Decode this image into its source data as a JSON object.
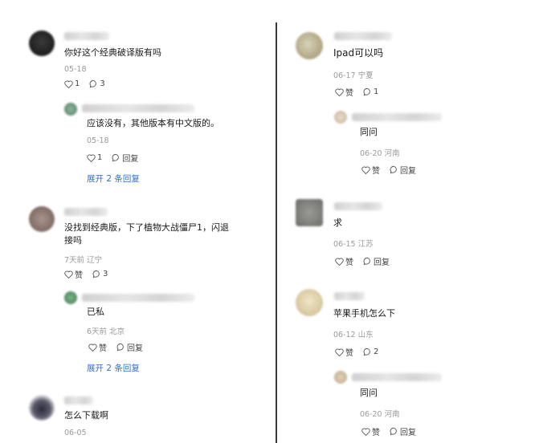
{
  "left_column": {
    "comments": [
      {
        "text": "你好这个经典破译版有吗",
        "date": "05-18",
        "like_count": "1",
        "comment_count": "3",
        "reply": {
          "text": "应该没有，其他版本有中文版的。",
          "date": "05-18",
          "like_count": "1",
          "reply_label": "回复"
        },
        "expand_label": "展开 2 条回复"
      },
      {
        "text_line1": "没找到经典版，下了植物大战僵尸1，闪退",
        "text_line2": "接吗",
        "meta": "7天前 辽宁",
        "like_label": "赞",
        "comment_count": "3",
        "reply": {
          "text": "已私",
          "meta": "6天前 北京",
          "like_label": "赞",
          "reply_label": "回复"
        },
        "expand_label": "展开 2 条回复"
      },
      {
        "text": "怎么下载啊",
        "date": "06-05"
      }
    ]
  },
  "right_column": {
    "comments": [
      {
        "text": "Ipad可以吗",
        "meta": "06-17 宁夏",
        "like_label": "赞",
        "comment_count": "1",
        "reply": {
          "text": "同问",
          "meta": "06-20 河南",
          "like_label": "赞",
          "reply_label": "回复"
        }
      },
      {
        "text": "求",
        "meta": "06-15 江苏",
        "like_label": "赞",
        "reply_label": "回复"
      },
      {
        "text": "苹果手机怎么下",
        "meta": "06-12 山东",
        "like_label": "赞",
        "comment_count": "2",
        "reply": {
          "text": "同问",
          "meta": "06-20 河南",
          "like_label": "赞",
          "reply_label": "回复"
        }
      }
    ]
  },
  "colors": {
    "link": "#2e6fd6",
    "meta": "#9a9a9a",
    "text": "#1a1a1a"
  }
}
